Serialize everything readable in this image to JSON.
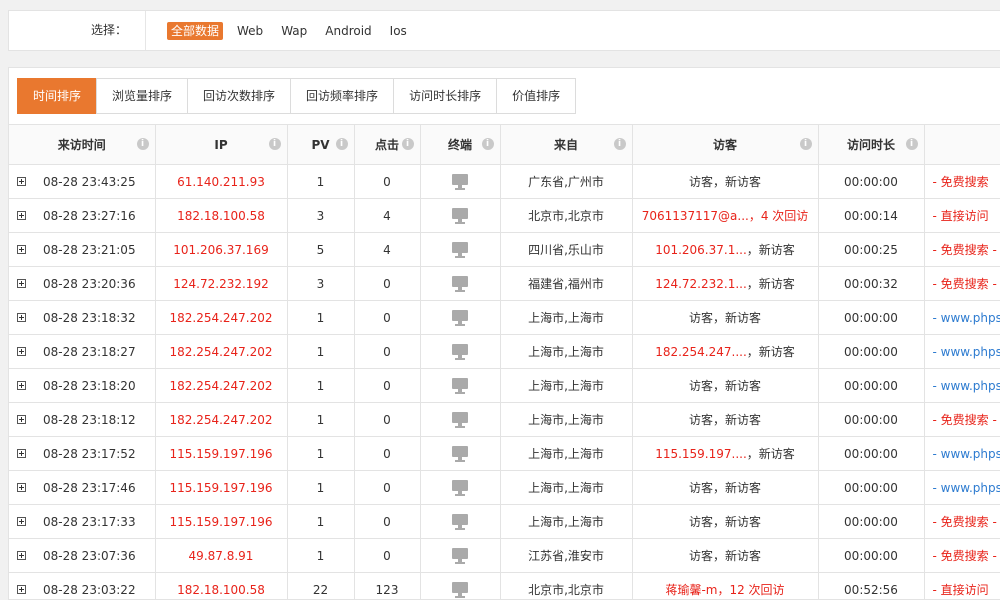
{
  "filter": {
    "label": "选择：",
    "options": [
      "全部数据",
      "Web",
      "Wap",
      "Android",
      "Ios"
    ],
    "active_index": 0
  },
  "tabs": [
    "时间排序",
    "浏览量排序",
    "回访次数排序",
    "回访频率排序",
    "访问时长排序",
    "价值排序"
  ],
  "active_tab": 0,
  "table": {
    "headers": [
      "来访时间",
      "IP",
      "PV",
      "点击",
      "终端",
      "来自",
      "访客",
      "访问时长"
    ],
    "info_icon_glyph": "i",
    "rows": [
      {
        "time": "08-28 23:43:25",
        "ip": "61.140.211.93",
        "pv": "1",
        "clicks": "0",
        "location": "广东省,广州市",
        "visitor_red": "",
        "visitor_rest": "访客，新访客",
        "duration": "00:00:00",
        "source": "- 免费搜索",
        "source_color": "red"
      },
      {
        "time": "08-28 23:27:16",
        "ip": "182.18.100.58",
        "pv": "3",
        "clicks": "4",
        "location": "北京市,北京市",
        "visitor_red": "7061137117@a...，4 次回访",
        "visitor_rest": "",
        "duration": "00:00:14",
        "source": "- 直接访问",
        "source_color": "red"
      },
      {
        "time": "08-28 23:21:05",
        "ip": "101.206.37.169",
        "pv": "5",
        "clicks": "4",
        "location": "四川省,乐山市",
        "visitor_red": "101.206.37.1...",
        "visitor_rest": "，新访客",
        "duration": "00:00:25",
        "source": "- 免费搜索 -",
        "source_color": "red"
      },
      {
        "time": "08-28 23:20:36",
        "ip": "124.72.232.192",
        "pv": "3",
        "clicks": "0",
        "location": "福建省,福州市",
        "visitor_red": "124.72.232.1...",
        "visitor_rest": "，新访客",
        "duration": "00:00:32",
        "source": "- 免费搜索 -",
        "source_color": "red"
      },
      {
        "time": "08-28 23:18:32",
        "ip": "182.254.247.202",
        "pv": "1",
        "clicks": "0",
        "location": "上海市,上海市",
        "visitor_red": "",
        "visitor_rest": "访客，新访客",
        "duration": "00:00:00",
        "source": "- www.phps",
        "source_color": "blue"
      },
      {
        "time": "08-28 23:18:27",
        "ip": "182.254.247.202",
        "pv": "1",
        "clicks": "0",
        "location": "上海市,上海市",
        "visitor_red": "182.254.247....",
        "visitor_rest": "，新访客",
        "duration": "00:00:00",
        "source": "- www.phps",
        "source_color": "blue"
      },
      {
        "time": "08-28 23:18:20",
        "ip": "182.254.247.202",
        "pv": "1",
        "clicks": "0",
        "location": "上海市,上海市",
        "visitor_red": "",
        "visitor_rest": "访客，新访客",
        "duration": "00:00:00",
        "source": "- www.phps",
        "source_color": "blue"
      },
      {
        "time": "08-28 23:18:12",
        "ip": "182.254.247.202",
        "pv": "1",
        "clicks": "0",
        "location": "上海市,上海市",
        "visitor_red": "",
        "visitor_rest": "访客，新访客",
        "duration": "00:00:00",
        "source": "- 免费搜索 -",
        "source_color": "red"
      },
      {
        "time": "08-28 23:17:52",
        "ip": "115.159.197.196",
        "pv": "1",
        "clicks": "0",
        "location": "上海市,上海市",
        "visitor_red": "115.159.197....",
        "visitor_rest": "，新访客",
        "duration": "00:00:00",
        "source": "- www.phps",
        "source_color": "blue"
      },
      {
        "time": "08-28 23:17:46",
        "ip": "115.159.197.196",
        "pv": "1",
        "clicks": "0",
        "location": "上海市,上海市",
        "visitor_red": "",
        "visitor_rest": "访客，新访客",
        "duration": "00:00:00",
        "source": "- www.phps",
        "source_color": "blue"
      },
      {
        "time": "08-28 23:17:33",
        "ip": "115.159.197.196",
        "pv": "1",
        "clicks": "0",
        "location": "上海市,上海市",
        "visitor_red": "",
        "visitor_rest": "访客，新访客",
        "duration": "00:00:00",
        "source": "- 免费搜索 -",
        "source_color": "red"
      },
      {
        "time": "08-28 23:07:36",
        "ip": "49.87.8.91",
        "pv": "1",
        "clicks": "0",
        "location": "江苏省,淮安市",
        "visitor_red": "",
        "visitor_rest": "访客，新访客",
        "duration": "00:00:00",
        "source": "- 免费搜索 -",
        "source_color": "red"
      },
      {
        "time": "08-28 23:03:22",
        "ip": "182.18.100.58",
        "pv": "22",
        "clicks": "123",
        "location": "北京市,北京市",
        "visitor_red": "蒋瑜馨-m，12 次回访",
        "visitor_rest": "",
        "duration": "00:52:56",
        "source": "- 直接访问",
        "source_color": "red"
      }
    ]
  },
  "colors": {
    "accent": "#e9782f",
    "red_text": "#e8231a",
    "blue_text": "#2d7bd0"
  },
  "icons": {
    "expand": "plus-square-icon",
    "terminal": "desktop-monitor-icon",
    "header_info": "info-circle-icon"
  }
}
